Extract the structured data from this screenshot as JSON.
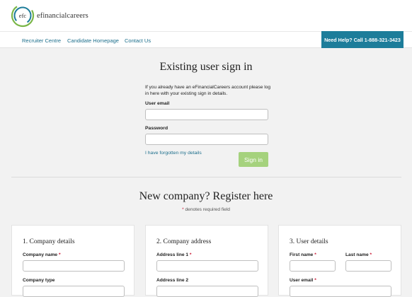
{
  "header": {
    "logo_monogram": "efc",
    "logo_text": "efinancialcareers",
    "brand_colors": {
      "teal": "#1d7d9a",
      "green": "#7ab648"
    }
  },
  "nav": {
    "links": [
      "Recruiter Centre",
      "Candidate Homepage",
      "Contact Us"
    ],
    "help_button": "Need Help? Call 1-888-321-3423"
  },
  "signin": {
    "title": "Existing user sign in",
    "intro": "If you already have an eFinancialCareers account please log in here with your existing sign in details.",
    "email_label": "User email",
    "password_label": "Password",
    "forgot_link": "I have forgotten my details",
    "button": "Sign in"
  },
  "register": {
    "title": "New company? Register here",
    "required_star": "*",
    "required_note": "denotes required field",
    "cards": [
      {
        "title": "1. Company details",
        "fields": [
          {
            "label": "Company name",
            "required": "*"
          },
          {
            "label": "Company type",
            "required": ""
          }
        ]
      },
      {
        "title": "2. Company address",
        "fields": [
          {
            "label": "Address line 1",
            "required": "*"
          },
          {
            "label": "Address line 2",
            "required": ""
          }
        ]
      },
      {
        "title": "3. User details",
        "fields": [
          {
            "label": "First name",
            "required": "*"
          },
          {
            "label": "Last name",
            "required": "*"
          },
          {
            "label": "User email",
            "required": "*"
          }
        ]
      }
    ]
  }
}
